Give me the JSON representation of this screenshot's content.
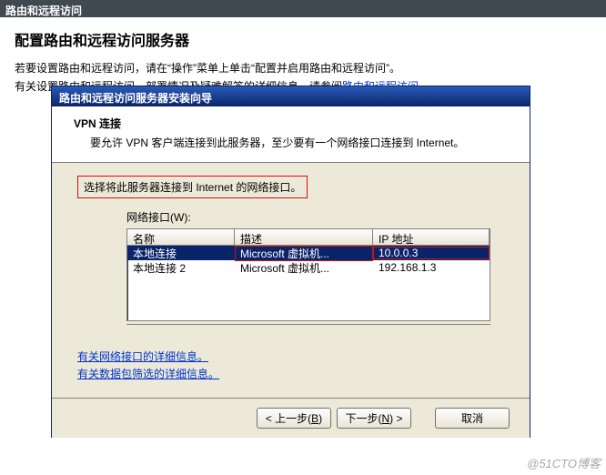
{
  "title_bar": "路由和远程访问",
  "page": {
    "title": "配置路由和远程访问服务器",
    "intro_line1_a": "若要设置路由和远程访问，请在“操作”菜单上单击“配置并启用路由和远程访问”。",
    "intro_line2_a": "有关设置路由和远程访问、部署情况及疑难解答的详细信息，请参阅",
    "intro_link": "路由和远程访问",
    "intro_line2_b": "。"
  },
  "wizard": {
    "title": "路由和远程访问服务器安装向导",
    "header_title": "VPN 连接",
    "header_desc": "要允许 VPN 客户端连接到此服务器，至少要有一个网络接口连接到 Internet。",
    "instruction": "选择将此服务器连接到 Internet 的网络接口。",
    "label": "网络接口(W):",
    "columns": {
      "name": "名称",
      "desc": "描述",
      "ip": "IP 地址"
    },
    "rows": [
      {
        "name": "本地连接",
        "desc": "Microsoft 虚拟机...",
        "ip": "10.0.0.3",
        "selected": true
      },
      {
        "name": "本地连接 2",
        "desc": "Microsoft 虚拟机...",
        "ip": "192.168.1.3",
        "selected": false
      }
    ],
    "info_link1": "有关网络接口的详细信息。",
    "info_link2": "有关数据包筛选的详细信息。",
    "buttons": {
      "back_pre": "< 上一步(",
      "back_u": "B",
      "back_post": ")",
      "next_pre": "下一步(",
      "next_u": "N",
      "next_post": ") >",
      "cancel": "取消"
    }
  },
  "watermark": "@51CTO博客"
}
